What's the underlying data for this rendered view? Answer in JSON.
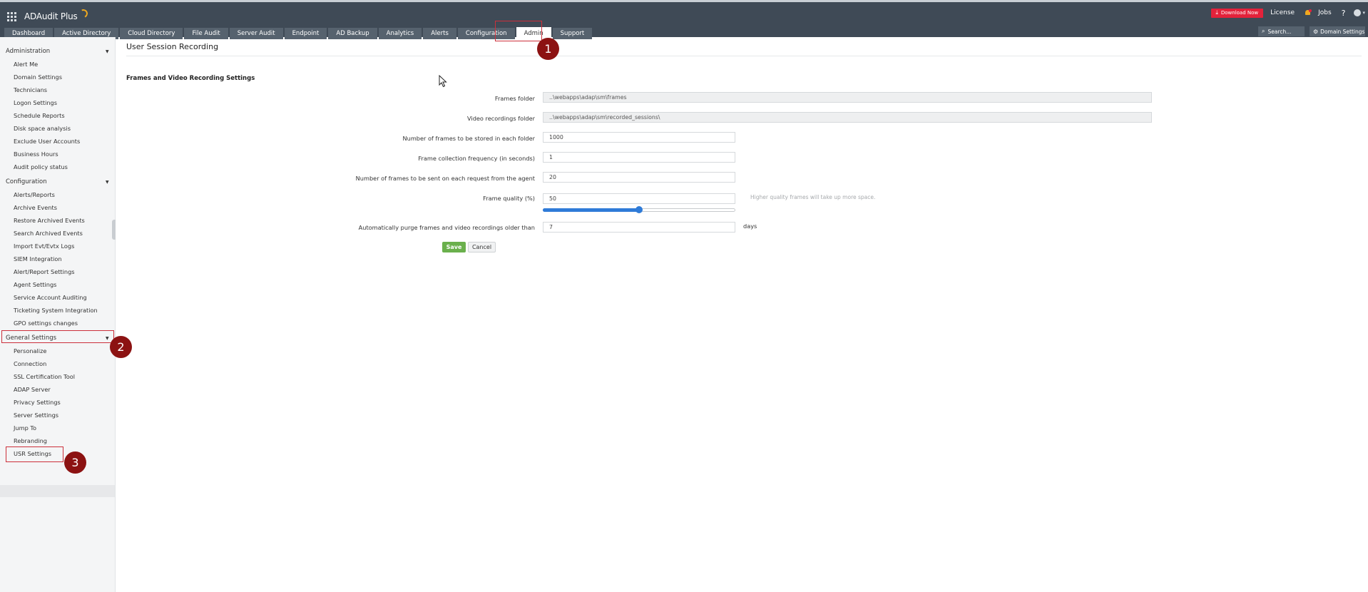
{
  "app": {
    "name": "ADAudit Plus",
    "download_label": "Download Now",
    "license_label": "License",
    "jobs_label": "Jobs",
    "help_label": "?",
    "search_placeholder": "Search...",
    "domain_settings_label": "Domain Settings"
  },
  "tabs": [
    {
      "label": "Dashboard",
      "active": false
    },
    {
      "label": "Active Directory",
      "active": false
    },
    {
      "label": "Cloud Directory",
      "active": false
    },
    {
      "label": "File Audit",
      "active": false
    },
    {
      "label": "Server Audit",
      "active": false
    },
    {
      "label": "Endpoint",
      "active": false
    },
    {
      "label": "AD Backup",
      "active": false
    },
    {
      "label": "Analytics",
      "active": false
    },
    {
      "label": "Alerts",
      "active": false
    },
    {
      "label": "Configuration",
      "active": false
    },
    {
      "label": "Admin",
      "active": true
    },
    {
      "label": "Support",
      "active": false
    }
  ],
  "sidebar": {
    "sections": [
      {
        "title": "Administration",
        "items": [
          "Alert Me",
          "Domain Settings",
          "Technicians",
          "Logon Settings",
          "Schedule Reports",
          "Disk space analysis",
          "Exclude User Accounts",
          "Business Hours",
          "Audit policy status"
        ]
      },
      {
        "title": "Configuration",
        "items": [
          "Alerts/Reports",
          "Archive Events",
          "Restore Archived Events",
          "Search Archived Events",
          "Import Evt/Evtx Logs",
          "SIEM Integration",
          "Alert/Report Settings",
          "Agent Settings",
          "Service Account Auditing",
          "Ticketing System Integration",
          "GPO settings changes"
        ]
      },
      {
        "title": "General Settings",
        "items": [
          "Personalize",
          "Connection",
          "SSL Certification Tool",
          "ADAP Server",
          "Privacy Settings",
          "Server Settings",
          "Jump To",
          "Rebranding",
          "USR Settings"
        ]
      }
    ],
    "selected_item": "USR Settings"
  },
  "main": {
    "page_title": "User Session Recording",
    "section_title": "Frames and Video Recording Settings",
    "fields": {
      "frames_folder": {
        "label": "Frames folder",
        "value": "..\\webapps\\adap\\sm\\frames"
      },
      "video_folder": {
        "label": "Video recordings folder",
        "value": "..\\webapps\\adap\\sm\\recorded_sessions\\"
      },
      "frames_per_folder": {
        "label": "Number of frames to be stored in each folder",
        "value": "1000"
      },
      "collection_frequency": {
        "label": "Frame collection frequency (in seconds)",
        "value": "1"
      },
      "frames_per_request": {
        "label": "Number of frames to be sent on each request from the agent",
        "value": "20"
      },
      "frame_quality": {
        "label": "Frame quality (%)",
        "value": "50",
        "hint": "Higher quality frames will take up more space.",
        "slider_percent": 50
      },
      "purge_older_than": {
        "label": "Automatically purge frames and video recordings older than",
        "value": "7",
        "unit": "days"
      }
    },
    "save_label": "Save",
    "cancel_label": "Cancel"
  },
  "annotations": [
    "1",
    "2",
    "3"
  ],
  "colors": {
    "header": "#3f4a56",
    "tab": "#56626e",
    "download": "#e3223b",
    "save": "#6ab04c",
    "slider": "#2f7bd8",
    "highlight": "#cc2f3a",
    "marker": "#8c1212"
  }
}
